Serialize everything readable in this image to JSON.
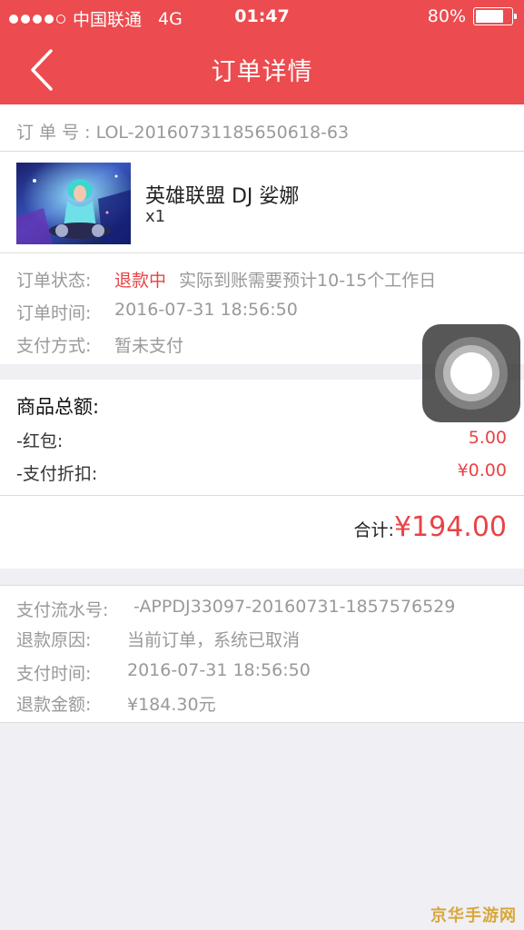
{
  "status_bar": {
    "carrier": "中国联通",
    "network": "4G",
    "time": "01:47",
    "battery_pct": "80%",
    "battery_level": 0.8
  },
  "nav": {
    "title": "订单详情",
    "back_icon": "chevron-left-icon"
  },
  "order": {
    "number_label": "订 单 号 : ",
    "number": "LOL-20160731185650618-63"
  },
  "product": {
    "name": "英雄联盟 DJ 娑娜",
    "qty": "x1"
  },
  "info": {
    "status_label": "订单状态:",
    "status_value": "退款中",
    "status_note": "实际到账需要预计10-15个工作日",
    "time_label": "订单时间:",
    "time_value": "2016-07-31 18:56:50",
    "pay_method_label": "支付方式:",
    "pay_method_value": "暂未支付"
  },
  "summary": {
    "title": "商品总额:",
    "redpacket_label": "-红包:",
    "redpacket_value": "5.00",
    "discount_label": "-支付折扣:",
    "discount_value": "¥0.00",
    "total_label": "合计:",
    "total_value": "¥194.00"
  },
  "payment": {
    "serial_label": "支付流水号:",
    "serial_value": "-APPDJ33097-20160731-1857576529",
    "reason_label": "退款原因:",
    "reason_value": "当前订单，系统已取消",
    "pay_time_label": "支付时间:",
    "pay_time_value": "2016-07-31 18:56:50",
    "refund_label": "退款金额:",
    "refund_value": "¥184.30元"
  },
  "watermark": "京华手游网",
  "colors": {
    "header": "#ec4b4f",
    "accent_red": "#e84346"
  }
}
